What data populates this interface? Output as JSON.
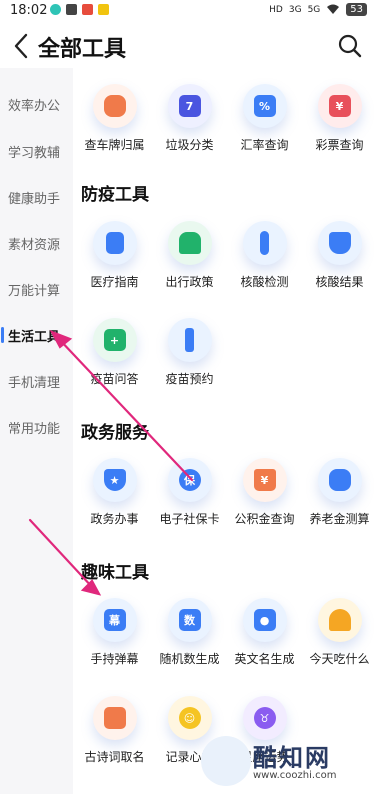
{
  "status": {
    "time": "18:02",
    "network_badges": [
      "HD",
      "3G",
      "5G"
    ],
    "battery": "53"
  },
  "header": {
    "title": "全部工具"
  },
  "sidebar": {
    "items": [
      {
        "label": "效率办公"
      },
      {
        "label": "学习教辅"
      },
      {
        "label": "健康助手"
      },
      {
        "label": "素材资源"
      },
      {
        "label": "万能计算"
      },
      {
        "label": "生活工具"
      },
      {
        "label": "手机清理"
      },
      {
        "label": "常用功能"
      }
    ],
    "active_index": 5
  },
  "sections": {
    "top_row": [
      {
        "label": "查车牌归属"
      },
      {
        "label": "垃圾分类"
      },
      {
        "label": "汇率查询"
      },
      {
        "label": "彩票查询"
      }
    ],
    "epidemic": {
      "title": "防疫工具",
      "tools": [
        {
          "label": "医疗指南"
        },
        {
          "label": "出行政策"
        },
        {
          "label": "核酸检测"
        },
        {
          "label": "核酸结果"
        },
        {
          "label": "疫苗问答"
        },
        {
          "label": "疫苗预约"
        }
      ]
    },
    "government": {
      "title": "政务服务",
      "tools": [
        {
          "label": "政务办事"
        },
        {
          "label": "电子社保卡"
        },
        {
          "label": "公积金查询"
        },
        {
          "label": "养老金测算"
        }
      ]
    },
    "fun": {
      "title": "趣味工具",
      "tools": [
        {
          "label": "手持弹幕"
        },
        {
          "label": "随机数生成"
        },
        {
          "label": "英文名生成"
        },
        {
          "label": "今天吃什么"
        },
        {
          "label": "古诗词取名"
        },
        {
          "label": "记录心情"
        },
        {
          "label": "星座运势"
        }
      ]
    }
  },
  "icon_glyphs": {
    "rubbish": "7",
    "exchange": "%",
    "lottery": "¥",
    "social_card": "保",
    "fund": "¥",
    "danmu": "幕",
    "random": "数"
  },
  "colors": {
    "accent": "#3b7df5",
    "arrow": "#e0287c"
  },
  "watermark": {
    "name": "酷知网",
    "url": "www.coozhi.com"
  }
}
